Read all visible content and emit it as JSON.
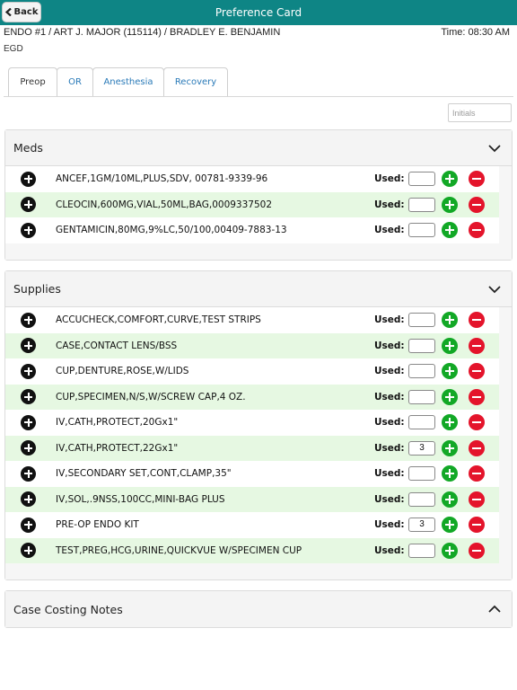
{
  "header": {
    "back_label": "Back",
    "title": "Preference Card"
  },
  "case": {
    "info": "ENDO #1 / ART J. MAJOR (115114) / BRADLEY E. BENJAMIN",
    "time": "Time: 08:30 AM",
    "procedure": "EGD"
  },
  "tabs": [
    {
      "label": "Preop",
      "active": true
    },
    {
      "label": "OR",
      "active": false
    },
    {
      "label": "Anesthesia",
      "active": false
    },
    {
      "label": "Recovery",
      "active": false
    }
  ],
  "initials": {
    "placeholder": "Initials",
    "value": ""
  },
  "used_label": "Used:",
  "meds": {
    "title": "Meds",
    "expanded": true,
    "items": [
      {
        "name": "ANCEF,1GM/10ML,PLUS,SDV, 00781-9339-96",
        "used": ""
      },
      {
        "name": "CLEOCIN,600MG,VIAL,50ML,BAG,0009337502",
        "used": ""
      },
      {
        "name": "GENTAMICIN,80MG,9%LC,50/100,00409-7883-13",
        "used": ""
      }
    ]
  },
  "supplies": {
    "title": "Supplies",
    "expanded": true,
    "items": [
      {
        "name": "ACCUCHECK,COMFORT,CURVE,TEST STRIPS",
        "used": ""
      },
      {
        "name": "CASE,CONTACT LENS/BSS",
        "used": ""
      },
      {
        "name": "CUP,DENTURE,ROSE,W/LIDS",
        "used": ""
      },
      {
        "name": "CUP,SPECIMEN,N/S,W/SCREW CAP,4 OZ.",
        "used": ""
      },
      {
        "name": "IV,CATH,PROTECT,20Gx1\"",
        "used": ""
      },
      {
        "name": "IV,CATH,PROTECT,22Gx1\"",
        "used": "3"
      },
      {
        "name": "IV,SECONDARY SET,CONT,CLAMP,35\"",
        "used": ""
      },
      {
        "name": "IV,SOL,.9NSS,100CC,MINI-BAG PLUS",
        "used": ""
      },
      {
        "name": "PRE-OP ENDO KIT",
        "used": "3"
      },
      {
        "name": "TEST,PREG,HCG,URINE,QUICKVUE W/SPECIMEN CUP",
        "used": ""
      }
    ]
  },
  "notes": {
    "title": "Case Costing Notes",
    "expanded": false
  },
  "colors": {
    "header_bg": "#0e8585",
    "alt_row_bg": "#e6f8e2",
    "add_green": "#12a826",
    "remove_red": "#e4142b",
    "tab_link": "#2a7ab8"
  },
  "icons": {
    "back": "chevron-left-icon",
    "panel_expanded": "chevron-down-icon",
    "panel_collapsed": "chevron-up-icon",
    "add_item": "plus-circle-icon",
    "increment": "plus-circle-green-icon",
    "decrement": "minus-circle-red-icon"
  }
}
